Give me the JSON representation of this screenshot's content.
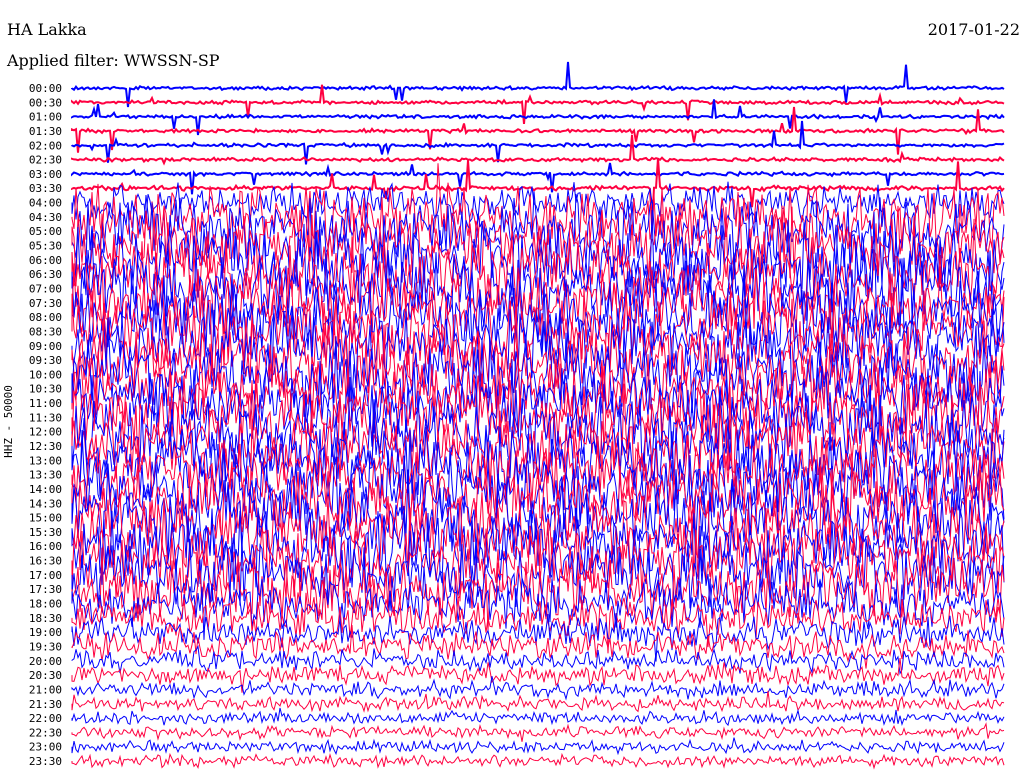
{
  "header": {
    "station": "HA Lakka",
    "filter": "Applied filter: WWSSN-SP",
    "date": "2017-01-22"
  },
  "chart_data": {
    "type": "line",
    "title": "HA Lakka",
    "subtitle": "Applied filter: WWSSN-SP",
    "ylabel": "HHZ - 50000",
    "colors": [
      "#0000ff",
      "#ff0040"
    ],
    "rows": [
      "00:00",
      "00:30",
      "01:00",
      "01:30",
      "02:00",
      "02:30",
      "03:00",
      "03:30",
      "04:00",
      "04:30",
      "05:00",
      "05:30",
      "06:00",
      "06:30",
      "07:00",
      "07:30",
      "08:00",
      "08:30",
      "09:00",
      "09:30",
      "10:00",
      "10:30",
      "11:00",
      "11:30",
      "12:00",
      "12:30",
      "13:00",
      "13:30",
      "14:00",
      "14:30",
      "15:00",
      "15:30",
      "16:00",
      "16:30",
      "17:00",
      "17:30",
      "18:00",
      "18:30",
      "19:00",
      "19:30",
      "20:00",
      "20:30",
      "21:00",
      "21:30",
      "22:00",
      "22:30",
      "23:00",
      "23:30"
    ],
    "relative_amplitude": [
      0.15,
      0.15,
      0.15,
      0.15,
      0.15,
      0.15,
      0.15,
      0.2,
      1.5,
      2.5,
      3,
      3,
      3,
      3,
      3,
      3,
      3,
      3,
      3,
      3,
      3,
      3,
      3,
      3,
      3,
      3,
      3,
      3,
      3,
      3,
      3,
      3,
      3,
      3,
      2.8,
      2.5,
      2,
      1.6,
      1.3,
      1.1,
      0.9,
      0.8,
      0.7,
      0.6,
      0.55,
      0.5,
      0.5,
      0.5
    ]
  }
}
